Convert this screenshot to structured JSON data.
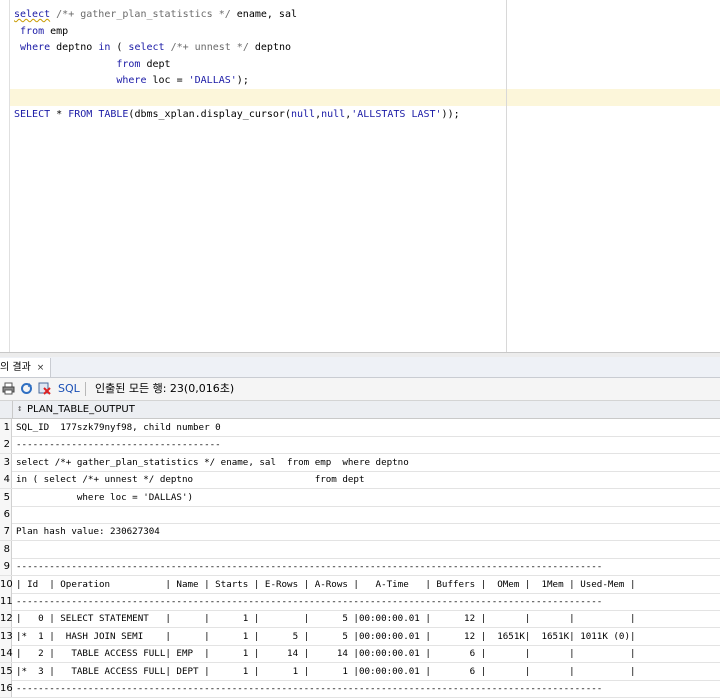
{
  "editor": {
    "lines": [
      {
        "parts": [
          {
            "t": "select",
            "c": "kw wavy"
          },
          {
            "t": " "
          },
          {
            "t": "/*+ gather_plan_statistics */",
            "c": "cm"
          },
          {
            "t": " ename, sal"
          }
        ]
      },
      {
        "parts": [
          {
            "t": " "
          },
          {
            "t": "from",
            "c": "kw"
          },
          {
            "t": " emp"
          }
        ]
      },
      {
        "parts": [
          {
            "t": " "
          },
          {
            "t": "where",
            "c": "kw"
          },
          {
            "t": " deptno "
          },
          {
            "t": "in",
            "c": "kw"
          },
          {
            "t": " ( "
          },
          {
            "t": "select",
            "c": "kw"
          },
          {
            "t": " "
          },
          {
            "t": "/*+ unnest */",
            "c": "cm"
          },
          {
            "t": " deptno"
          }
        ]
      },
      {
        "parts": [
          {
            "t": "                 "
          },
          {
            "t": "from",
            "c": "kw"
          },
          {
            "t": " dept"
          }
        ]
      },
      {
        "parts": [
          {
            "t": "                 "
          },
          {
            "t": "where",
            "c": "kw"
          },
          {
            "t": " loc = "
          },
          {
            "t": "'DALLAS'",
            "c": "str"
          },
          {
            "t": ");"
          }
        ]
      },
      {
        "parts": []
      },
      {
        "parts": [
          {
            "t": "SELECT",
            "c": "kw"
          },
          {
            "t": " * "
          },
          {
            "t": "FROM",
            "c": "kw"
          },
          {
            "t": " "
          },
          {
            "t": "TABLE",
            "c": "kw"
          },
          {
            "t": "(dbms_xplan.display_cursor("
          },
          {
            "t": "null",
            "c": "kw"
          },
          {
            "t": ","
          },
          {
            "t": "null",
            "c": "kw"
          },
          {
            "t": ","
          },
          {
            "t": "'ALLSTATS LAST'",
            "c": "str"
          },
          {
            "t": "));"
          }
        ]
      }
    ]
  },
  "results_tab": {
    "label": "의 결과",
    "close": "×"
  },
  "toolbar": {
    "sql_label": "SQL",
    "status": "인출된 모든 행: 23(0,016초)"
  },
  "grid": {
    "column": "PLAN_TABLE_OUTPUT",
    "rows": [
      {
        "n": "1",
        "text": "SQL_ID  177szk79nyf98, child number 0"
      },
      {
        "n": "2",
        "text": "-------------------------------------"
      },
      {
        "n": "3",
        "text": "select /*+ gather_plan_statistics */ ename, sal  from emp  where deptno"
      },
      {
        "n": "4",
        "text": "in ( select /*+ unnest */ deptno                      from dept"
      },
      {
        "n": "5",
        "text": "           where loc = 'DALLAS')"
      },
      {
        "n": "6",
        "text": ""
      },
      {
        "n": "7",
        "text": "Plan hash value: 230627304"
      },
      {
        "n": "8",
        "text": ""
      },
      {
        "n": "9",
        "text": "----------------------------------------------------------------------------------------------------------"
      },
      {
        "n": "10",
        "text": "| Id  | Operation          | Name | Starts | E-Rows | A-Rows |   A-Time   | Buffers |  OMem |  1Mem | Used-Mem |"
      },
      {
        "n": "11",
        "text": "----------------------------------------------------------------------------------------------------------"
      },
      {
        "n": "12",
        "text": "|   0 | SELECT STATEMENT   |      |      1 |        |      5 |00:00:00.01 |      12 |       |       |          |"
      },
      {
        "n": "13",
        "text": "|*  1 |  HASH JOIN SEMI    |      |      1 |      5 |      5 |00:00:00.01 |      12 |  1651K|  1651K| 1011K (0)|"
      },
      {
        "n": "14",
        "text": "|   2 |   TABLE ACCESS FULL| EMP  |      1 |     14 |     14 |00:00:00.01 |       6 |       |       |          |"
      },
      {
        "n": "15",
        "text": "|*  3 |   TABLE ACCESS FULL| DEPT |      1 |      1 |      1 |00:00:00.01 |       6 |       |       |          |"
      },
      {
        "n": "16",
        "text": "----------------------------------------------------------------------------------------------------------"
      }
    ]
  }
}
